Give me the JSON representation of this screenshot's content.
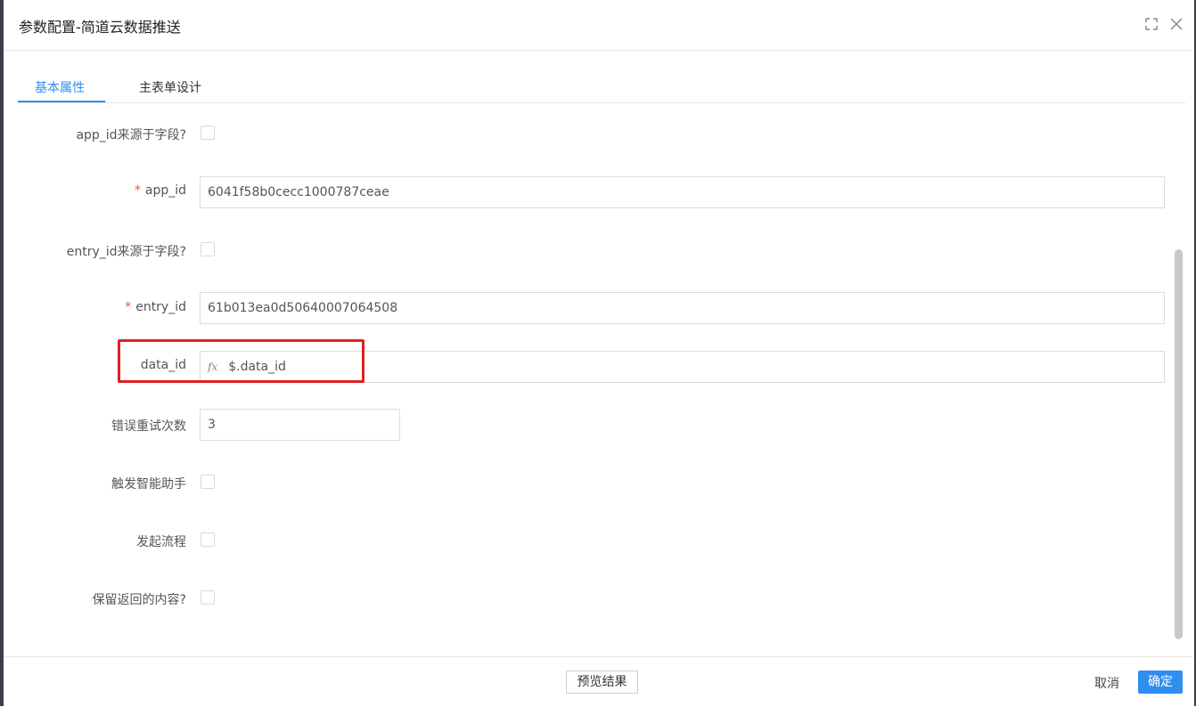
{
  "dialog": {
    "title": "参数配置-简道云数据推送",
    "icons": {
      "maximize": "maximize-icon",
      "close": "close-icon"
    }
  },
  "tabs": [
    {
      "label": "基本属性",
      "active": true
    },
    {
      "label": "主表单设计",
      "active": false
    }
  ],
  "form": {
    "app_id_from_field": {
      "label": "app_id来源于字段?",
      "checked": false
    },
    "app_id": {
      "label": "app_id",
      "required_mark": "*",
      "value": "6041f58b0cecc1000787ceae"
    },
    "entry_id_from_field": {
      "label": "entry_id来源于字段?",
      "checked": false
    },
    "entry_id": {
      "label": "entry_id",
      "required_mark": "*",
      "value": "61b013ea0d50640007064508"
    },
    "data_id": {
      "label": "data_id",
      "fx_symbol": "fx",
      "value": "$.data_id"
    },
    "retry_count": {
      "label": "错误重试次数",
      "value": "3"
    },
    "trigger_assistant": {
      "label": "触发智能助手",
      "checked": false
    },
    "start_process": {
      "label": "发起流程",
      "checked": false
    },
    "keep_response": {
      "label": "保留返回的内容?",
      "checked": false
    }
  },
  "footer": {
    "preview_label": "预览结果",
    "cancel_label": "取消",
    "ok_label": "确定"
  },
  "colors": {
    "accent": "#2f8ef0",
    "highlight": "#e02020",
    "required": "#e4572e"
  }
}
